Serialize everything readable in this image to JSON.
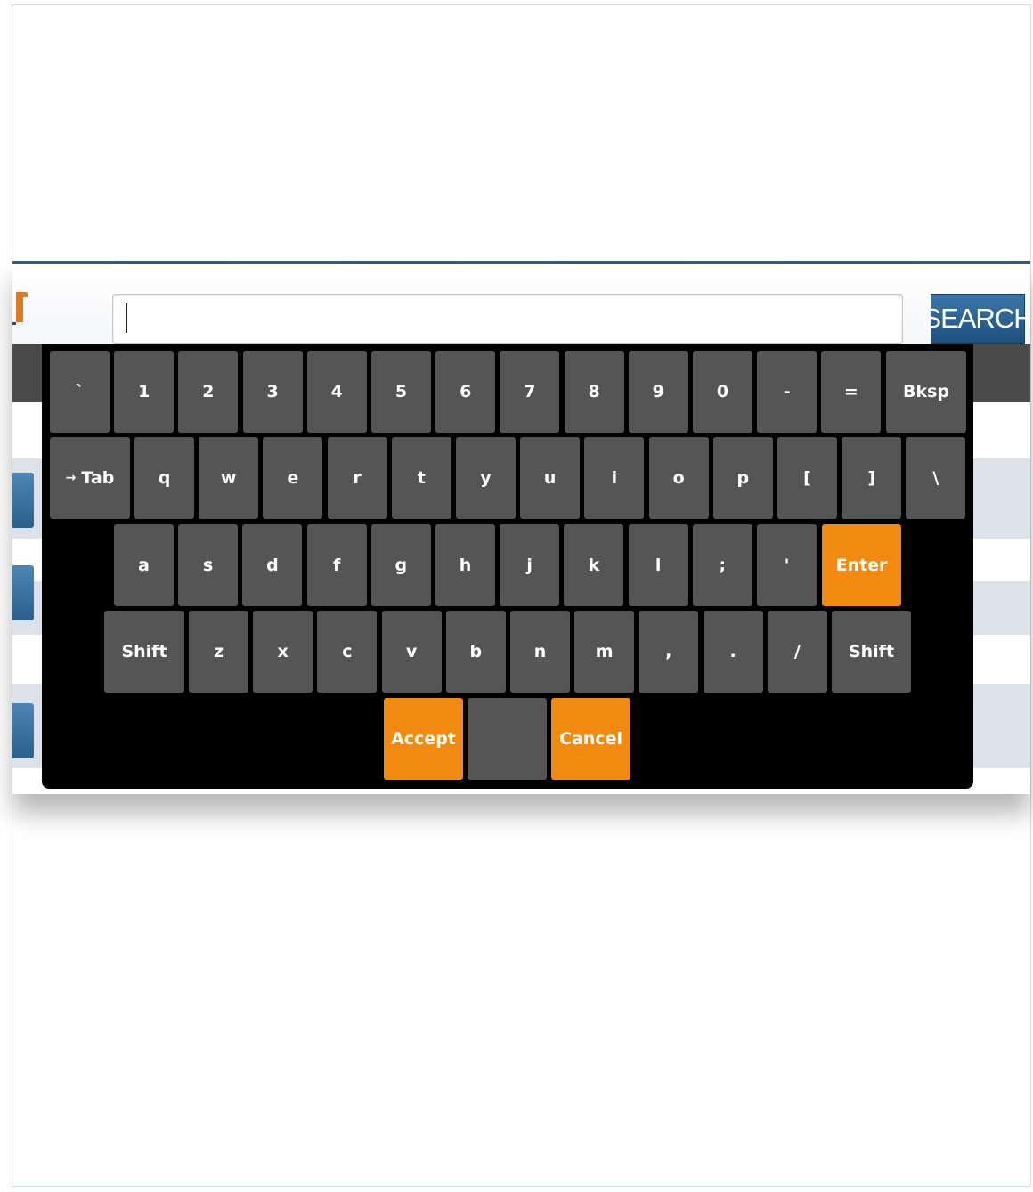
{
  "search": {
    "button_label": "SEARCH",
    "input_value": ""
  },
  "keyboard": {
    "row1": [
      "`",
      "1",
      "2",
      "3",
      "4",
      "5",
      "6",
      "7",
      "8",
      "9",
      "0",
      "-",
      "=",
      "Bksp"
    ],
    "row2": [
      "Tab",
      "q",
      "w",
      "e",
      "r",
      "t",
      "y",
      "u",
      "i",
      "o",
      "p",
      "[",
      "]",
      "\\"
    ],
    "row2_tab_icon": "tab-arrow-icon",
    "row3": [
      "a",
      "s",
      "d",
      "f",
      "g",
      "h",
      "j",
      "k",
      "l",
      ";",
      "'",
      "Enter"
    ],
    "row4": [
      "Shift",
      "z",
      "x",
      "c",
      "v",
      "b",
      "n",
      "m",
      ",",
      ".",
      "/",
      "Shift"
    ],
    "row5": [
      "Accept",
      "",
      "Cancel"
    ],
    "colors": {
      "key": "#555555",
      "accent": "#f28a0f",
      "background": "#000000"
    }
  },
  "colors": {
    "search_button": "#2b5f8c",
    "logo": "#e07a22"
  }
}
